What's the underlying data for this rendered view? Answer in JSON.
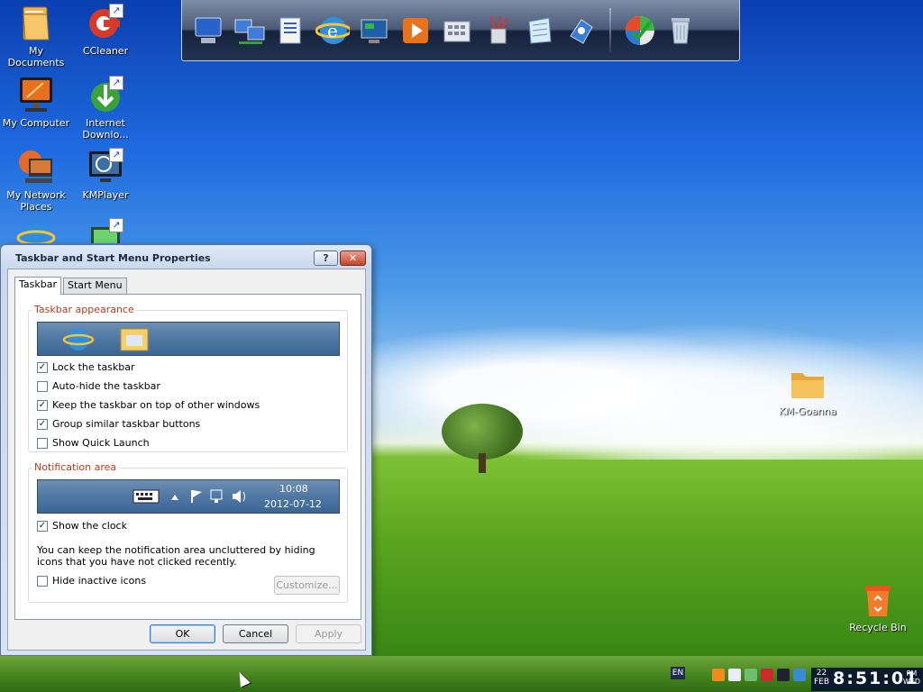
{
  "desktop": {
    "icons_left": [
      {
        "label": "My Documents"
      },
      {
        "label": "My Computer"
      },
      {
        "label": "My Network Places"
      },
      {
        "label": ""
      }
    ],
    "icons_right": [
      {
        "label": "CCleaner"
      },
      {
        "label": "Internet Downlo..."
      },
      {
        "label": "KMPlayer"
      },
      {
        "label": ""
      }
    ],
    "folder_label": "KM-Goanna",
    "recycle_label": "Recycle Bin"
  },
  "dock": {
    "items": [
      "my-computer-icon",
      "network-icon",
      "documents-icon",
      "internet-explorer-icon",
      "media-center-icon",
      "media-player-icon",
      "calculator-icon",
      "paint-icon",
      "notepad-icon",
      "control-panel-icon",
      "windows-update-icon",
      "recycle-bin-icon"
    ]
  },
  "dialog": {
    "title": "Taskbar and Start Menu Properties",
    "help": "?",
    "close": "✕",
    "tabs": [
      "Taskbar",
      "Start Menu"
    ],
    "taskbar_group": {
      "title": "Taskbar appearance",
      "options": [
        {
          "label": "Lock the taskbar",
          "checked": "✓"
        },
        {
          "label": "Auto-hide the taskbar",
          "checked": ""
        },
        {
          "label": "Keep the taskbar on top of other windows",
          "checked": "✓"
        },
        {
          "label": "Group similar taskbar buttons",
          "checked": "✓"
        },
        {
          "label": "Show Quick Launch",
          "checked": ""
        }
      ]
    },
    "notification_group": {
      "title": "Notification area",
      "preview_time": "10:08",
      "preview_date": "2012-07-12",
      "show_clock": {
        "label": "Show the clock",
        "checked": "✓"
      },
      "note": "You can keep the notification area uncluttered by hiding icons that you have not clicked recently.",
      "hide_inactive": {
        "label": "Hide inactive icons",
        "checked": ""
      },
      "customize": "Customize..."
    },
    "buttons": {
      "ok": "OK",
      "cancel": "Cancel",
      "apply": "Apply"
    }
  },
  "taskbar": {
    "lang": "EN",
    "clock": {
      "day": "22",
      "month": "FEB",
      "time": "8:51:01",
      "ampm": "PM",
      "weekday": "WED"
    }
  }
}
